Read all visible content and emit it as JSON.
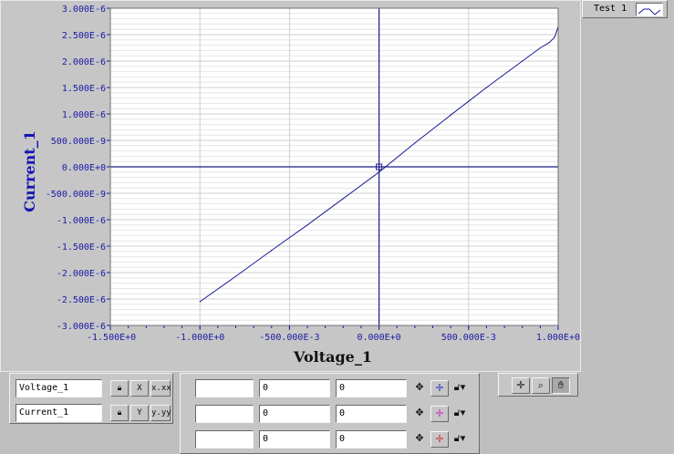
{
  "chart_data": {
    "type": "line",
    "xlabel": "Voltage_1",
    "ylabel": "Current_1",
    "xlim": [
      -1.5,
      1.0
    ],
    "ylim": [
      -3e-06,
      3e-06
    ],
    "x_ticks": [
      -1.5,
      -1.0,
      -0.5,
      0.0,
      0.5,
      1.0
    ],
    "x_tick_labels": [
      "-1.500E+0",
      "-1.000E+0",
      "-500.000E-3",
      "0.000E+0",
      "500.000E-3",
      "1.000E+0"
    ],
    "y_ticks": [
      3e-06,
      2.5e-06,
      2e-06,
      1.5e-06,
      1e-06,
      5e-07,
      0.0,
      -5e-07,
      -1e-06,
      -1.5e-06,
      -2e-06,
      -2.5e-06,
      -3e-06
    ],
    "y_tick_labels": [
      "3.000E-6",
      "2.500E-6",
      "2.000E-6",
      "1.500E-6",
      "1.000E-6",
      "500.000E-9",
      "0.000E+0",
      "-500.000E-9",
      "-1.000E-6",
      "-1.500E-6",
      "-2.000E-6",
      "-2.500E-6",
      "-3.000E-6"
    ],
    "grid": true,
    "legend": "top-right",
    "series": [
      {
        "name": "Test 1",
        "color": "#1a1a9a",
        "x": [
          -1.0,
          -0.8,
          -0.6,
          -0.4,
          -0.2,
          0.0,
          0.2,
          0.4,
          0.6,
          0.8,
          0.9,
          0.95,
          0.98,
          1.0
        ],
        "y": [
          -2.55e-06,
          -2.07e-06,
          -1.58e-06,
          -1.1e-06,
          -6e-07,
          -1e-07,
          4.5e-07,
          9.8e-07,
          1.5e-06,
          2e-06,
          2.25e-06,
          2.35e-06,
          2.45e-06,
          2.65e-06
        ]
      }
    ],
    "cursor": {
      "x": 0.0,
      "y": 0.0
    }
  },
  "legend": {
    "plot_name": "Test 1"
  },
  "scale_legend": {
    "rows": [
      {
        "name": "Voltage_1",
        "lock_icon": "lock-icon",
        "autoscale_label": "X",
        "format_label": "x.xx"
      },
      {
        "name": "Current_1",
        "lock_icon": "lock-icon",
        "autoscale_label": "Y",
        "format_label": "y.yy"
      }
    ]
  },
  "cursor_legend": {
    "rows": [
      {
        "name": "",
        "x": "0",
        "y": "0",
        "color": "#3333cc"
      },
      {
        "name": "",
        "x": "0",
        "y": "0",
        "color": "#cc33cc"
      },
      {
        "name": "",
        "x": "0",
        "y": "0",
        "color": "#cc3333"
      }
    ]
  },
  "palette": {
    "tools": [
      "cursor-tool-icon",
      "zoom-tool-icon",
      "pan-hand-icon"
    ]
  },
  "colors": {
    "plot_line": "#1a1a9a",
    "tick_text": "#1a1aa8",
    "ylabel": "#1414b4",
    "background": "#bfbfbf"
  }
}
